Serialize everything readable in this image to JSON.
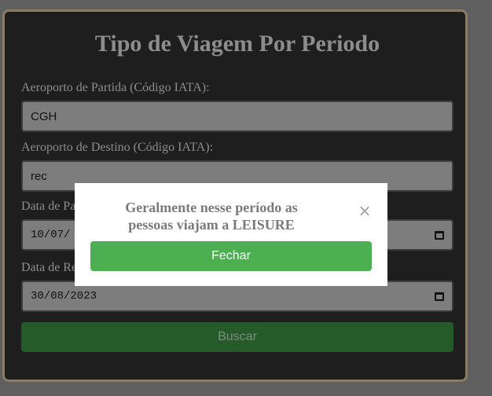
{
  "form": {
    "title": "Tipo de Viagem Por Periodo",
    "origin_label": "Aeroporto de Partida (Código IATA):",
    "origin_value": "CGH",
    "destination_label": "Aeroporto de Destino (Código IATA):",
    "destination_value": "rec",
    "departure_label_partial": "Data de Pa",
    "departure_value_partial": "10/07/",
    "return_label_partial": "Data de Re",
    "return_value": "30/08/2023",
    "search_label": "Buscar",
    "calendar_icon": "calendar-icon"
  },
  "modal": {
    "message": "Geralmente nesse período as pessoas viajam a LEISURE",
    "close_glyph": "×",
    "close_button_label": "Fechar",
    "colors": {
      "button": "#4caf50"
    }
  },
  "colors": {
    "card_background": "#1f1e1e",
    "card_border": "#8a7d64",
    "search_button": "#255a29"
  }
}
